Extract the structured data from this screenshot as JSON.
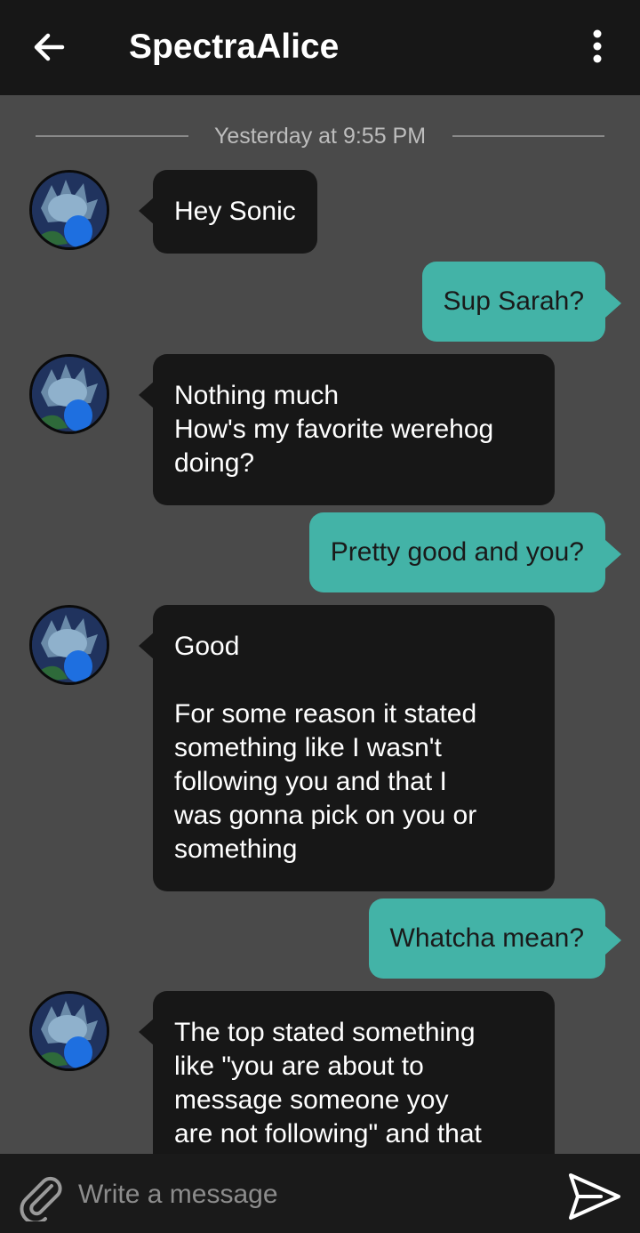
{
  "header": {
    "title": "SpectraAlice",
    "back_icon": "arrow-left-icon",
    "menu_icon": "more-vertical-icon"
  },
  "separator": {
    "text": "Yesterday at 9:55 PM"
  },
  "messages": [
    {
      "direction": "in",
      "text": "Hey Sonic"
    },
    {
      "direction": "out",
      "text": "Sup Sarah?"
    },
    {
      "direction": "in",
      "text": "Nothing much\nHow's my favorite werehog\ndoing?"
    },
    {
      "direction": "out",
      "text": "Pretty good and you?"
    },
    {
      "direction": "in",
      "text": "Good\n\nFor some reason it stated\nsomething like I wasn't\nfollowing you and that I\nwas gonna pick on you or\nsomething"
    },
    {
      "direction": "out",
      "text": "Whatcha mean?"
    },
    {
      "direction": "in",
      "text": "The top stated something\nlike \"you are about to\nmessage someone yoy\nare not following\" and that"
    }
  ],
  "composer": {
    "placeholder": "Write a message",
    "attach_icon": "paperclip-icon",
    "send_icon": "send-icon"
  },
  "colors": {
    "background": "#4a4a4a",
    "header": "#171717",
    "incoming_bubble": "#171717",
    "outgoing_bubble": "#43b3a7",
    "composer": "#1a1a1a"
  }
}
